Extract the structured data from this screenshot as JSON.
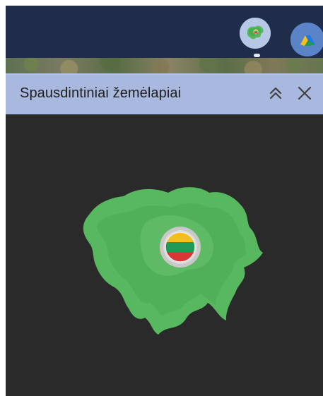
{
  "panel": {
    "title": "Spausdintiniai žemėlapiai"
  },
  "topbar": {
    "app_icons": [
      "lithuania-map-icon",
      "brand-triangle-icon"
    ]
  },
  "colors": {
    "topbar": "#1f2d4a",
    "panel_header": "#a8b8de",
    "panel_body": "#2a2a2a",
    "map_green": "#58b85f",
    "map_green_dark": "#43a44f",
    "flag_yellow": "#f6be1a",
    "flag_green": "#1f9a57",
    "flag_red": "#d93636"
  }
}
